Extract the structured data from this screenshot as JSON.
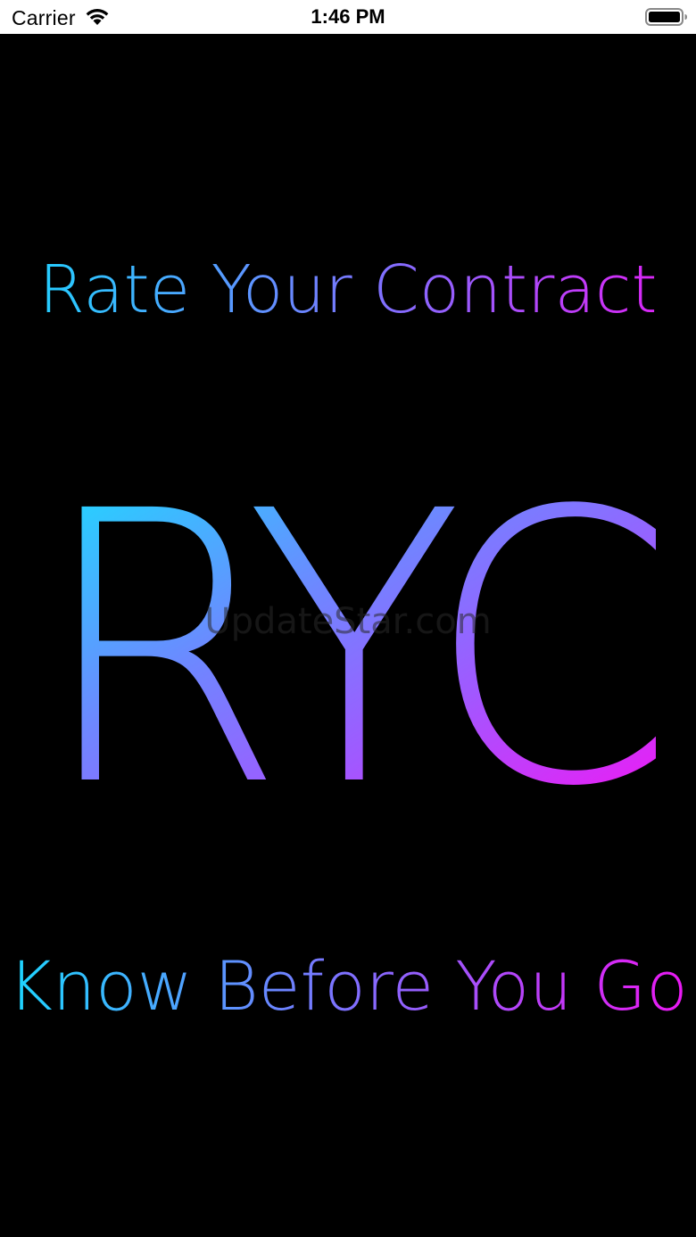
{
  "status_bar": {
    "carrier": "Carrier",
    "time": "1:46 PM",
    "wifi_icon": "wifi-icon",
    "battery_icon": "battery-icon"
  },
  "splash": {
    "top_tagline": "Rate Your Contract",
    "logo": "RYC",
    "bottom_tagline": "Know Before You Go",
    "watermark": "UpdateStar.com"
  },
  "colors": {
    "background": "#000000",
    "gradient_start": "#16dcff",
    "gradient_mid": "#7c73ff",
    "gradient_end": "#ff0ff4"
  }
}
